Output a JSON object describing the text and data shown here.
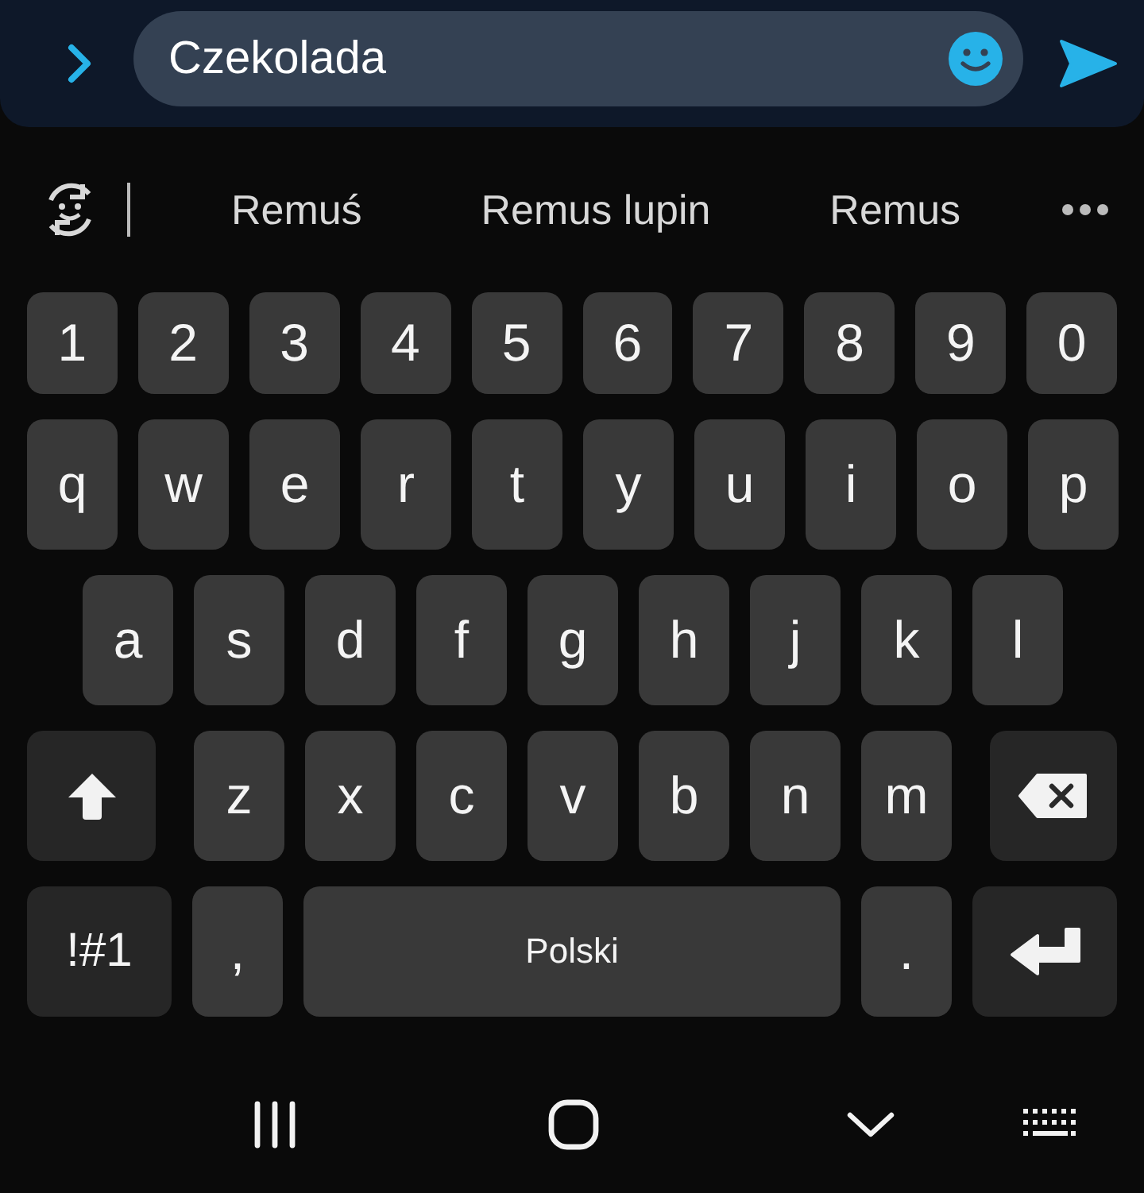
{
  "message_bar": {
    "value": "Czekolada"
  },
  "suggestions": [
    "Remuś",
    "Remus lupin",
    "Remus"
  ],
  "keyboard": {
    "rows": [
      [
        {
          "kind": "char",
          "label": "1"
        },
        {
          "kind": "char",
          "label": "2"
        },
        {
          "kind": "char",
          "label": "3"
        },
        {
          "kind": "char",
          "label": "4"
        },
        {
          "kind": "char",
          "label": "5"
        },
        {
          "kind": "char",
          "label": "6"
        },
        {
          "kind": "char",
          "label": "7"
        },
        {
          "kind": "char",
          "label": "8"
        },
        {
          "kind": "char",
          "label": "9"
        },
        {
          "kind": "char",
          "label": "0"
        }
      ],
      [
        {
          "kind": "char",
          "label": "q"
        },
        {
          "kind": "char",
          "label": "w"
        },
        {
          "kind": "char",
          "label": "e"
        },
        {
          "kind": "char",
          "label": "r"
        },
        {
          "kind": "char",
          "label": "t"
        },
        {
          "kind": "char",
          "label": "y"
        },
        {
          "kind": "char",
          "label": "u"
        },
        {
          "kind": "char",
          "label": "i"
        },
        {
          "kind": "char",
          "label": "o"
        },
        {
          "kind": "char",
          "label": "p"
        }
      ],
      [
        {
          "kind": "char",
          "label": "a"
        },
        {
          "kind": "char",
          "label": "s"
        },
        {
          "kind": "char",
          "label": "d"
        },
        {
          "kind": "char",
          "label": "f"
        },
        {
          "kind": "char",
          "label": "g"
        },
        {
          "kind": "char",
          "label": "h"
        },
        {
          "kind": "char",
          "label": "j"
        },
        {
          "kind": "char",
          "label": "k"
        },
        {
          "kind": "char",
          "label": "l"
        }
      ],
      [
        {
          "kind": "shift"
        },
        {
          "kind": "char",
          "label": "z"
        },
        {
          "kind": "char",
          "label": "x"
        },
        {
          "kind": "char",
          "label": "c"
        },
        {
          "kind": "char",
          "label": "v"
        },
        {
          "kind": "char",
          "label": "b"
        },
        {
          "kind": "char",
          "label": "n"
        },
        {
          "kind": "char",
          "label": "m"
        },
        {
          "kind": "backspace"
        }
      ],
      [
        {
          "kind": "symbols",
          "label": "!#1"
        },
        {
          "kind": "char",
          "label": ","
        },
        {
          "kind": "space",
          "label": "Polski"
        },
        {
          "kind": "char",
          "label": "."
        },
        {
          "kind": "enter"
        }
      ]
    ]
  }
}
